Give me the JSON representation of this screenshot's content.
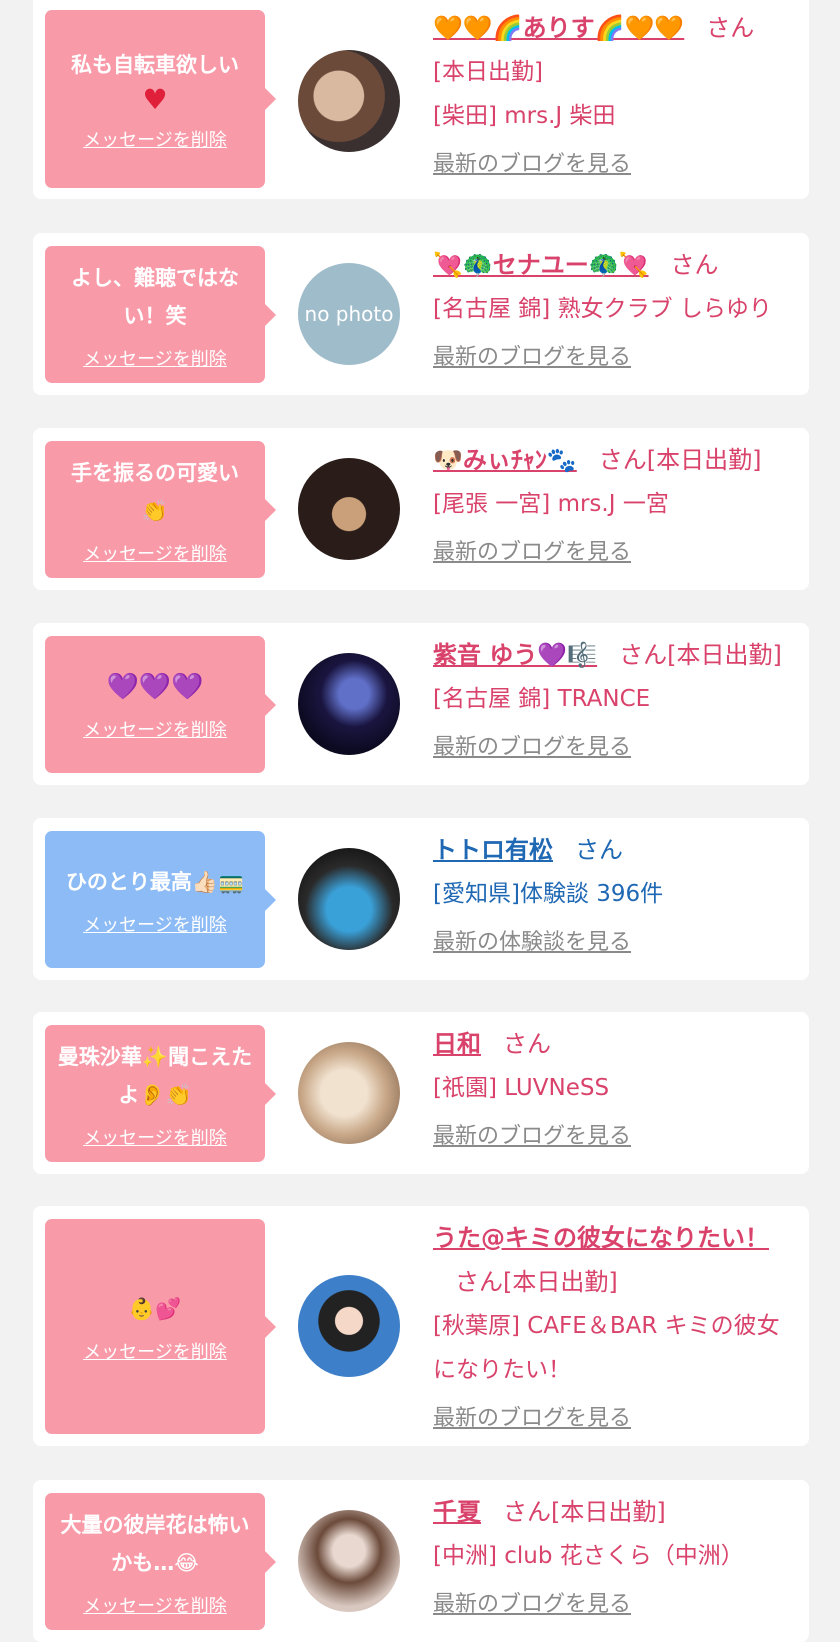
{
  "items": [
    {
      "message": "私も自転車欲しい",
      "message_extra": "♥",
      "delete_label": "メッセージを削除",
      "name": "🧡🧡🌈ありす🌈🧡🧡",
      "suffix": "さん",
      "status": "[本日出勤]",
      "shop": "[柴田] mrs.J 柴田",
      "blog_link": "最新のブログを見る"
    },
    {
      "message": "よし、難聴ではない！笑",
      "message_extra": "",
      "delete_label": "メッセージを削除",
      "name": "💘🦚セナユー🦚💘",
      "suffix": "さん",
      "status": "",
      "shop": "[名古屋 錦] 熟女クラブ しらゆり",
      "blog_link": "最新のブログを見る",
      "avatar_text": "no photo"
    },
    {
      "message": "手を振るの可愛い",
      "message_extra": "👏",
      "delete_label": "メッセージを削除",
      "name": "🐶みぃﾁｬﾝ🐾",
      "suffix": "さん[本日出勤]",
      "status": "",
      "shop": "[尾張 一宮] mrs.J 一宮",
      "blog_link": "最新のブログを見る"
    },
    {
      "message": "💜💜💜",
      "message_extra": "",
      "delete_label": "メッセージを削除",
      "name": "紫音 ゆう💜🎼",
      "suffix": "さん[本日出勤]",
      "status": "",
      "shop": "[名古屋 錦] TRANCE",
      "blog_link": "最新のブログを見る"
    },
    {
      "message": "ひのとり最高👍🏻🚃",
      "message_extra": "",
      "delete_label": "メッセージを削除",
      "name": "トトロ有松",
      "suffix": "さん",
      "status": "",
      "shop": "[愛知県]体験談 396件",
      "blog_link": "最新の体験談を見る"
    },
    {
      "message": "曼珠沙華✨聞こえたよ👂👏",
      "message_extra": "",
      "delete_label": "メッセージを削除",
      "name": "日和",
      "suffix": "さん",
      "status": "",
      "shop": "[祇園] LUVNeSS",
      "blog_link": "最新のブログを見る"
    },
    {
      "message": "👶💕",
      "message_extra": "",
      "delete_label": "メッセージを削除",
      "name": "うた@キミの彼女になりたい！",
      "suffix": "さん[本日出勤]",
      "status": "",
      "shop": "[秋葉原] CAFE＆BAR キミの彼女になりたい！",
      "blog_link": "最新のブログを見る"
    },
    {
      "message": "大量の彼岸花は怖いかも…😂",
      "message_extra": "",
      "delete_label": "メッセージを削除",
      "name": "千夏",
      "suffix": "さん[本日出勤]",
      "status": "",
      "shop": "[中洲] club 花さくら（中洲）",
      "blog_link": "最新のブログを見る"
    }
  ],
  "colors": {
    "bubble_pink": "#f99aa8",
    "bubble_blue": "#8dbbf5",
    "name_pink": "#d9436b",
    "name_blue": "#1f68b3",
    "link_gray": "#8a8a8a"
  }
}
